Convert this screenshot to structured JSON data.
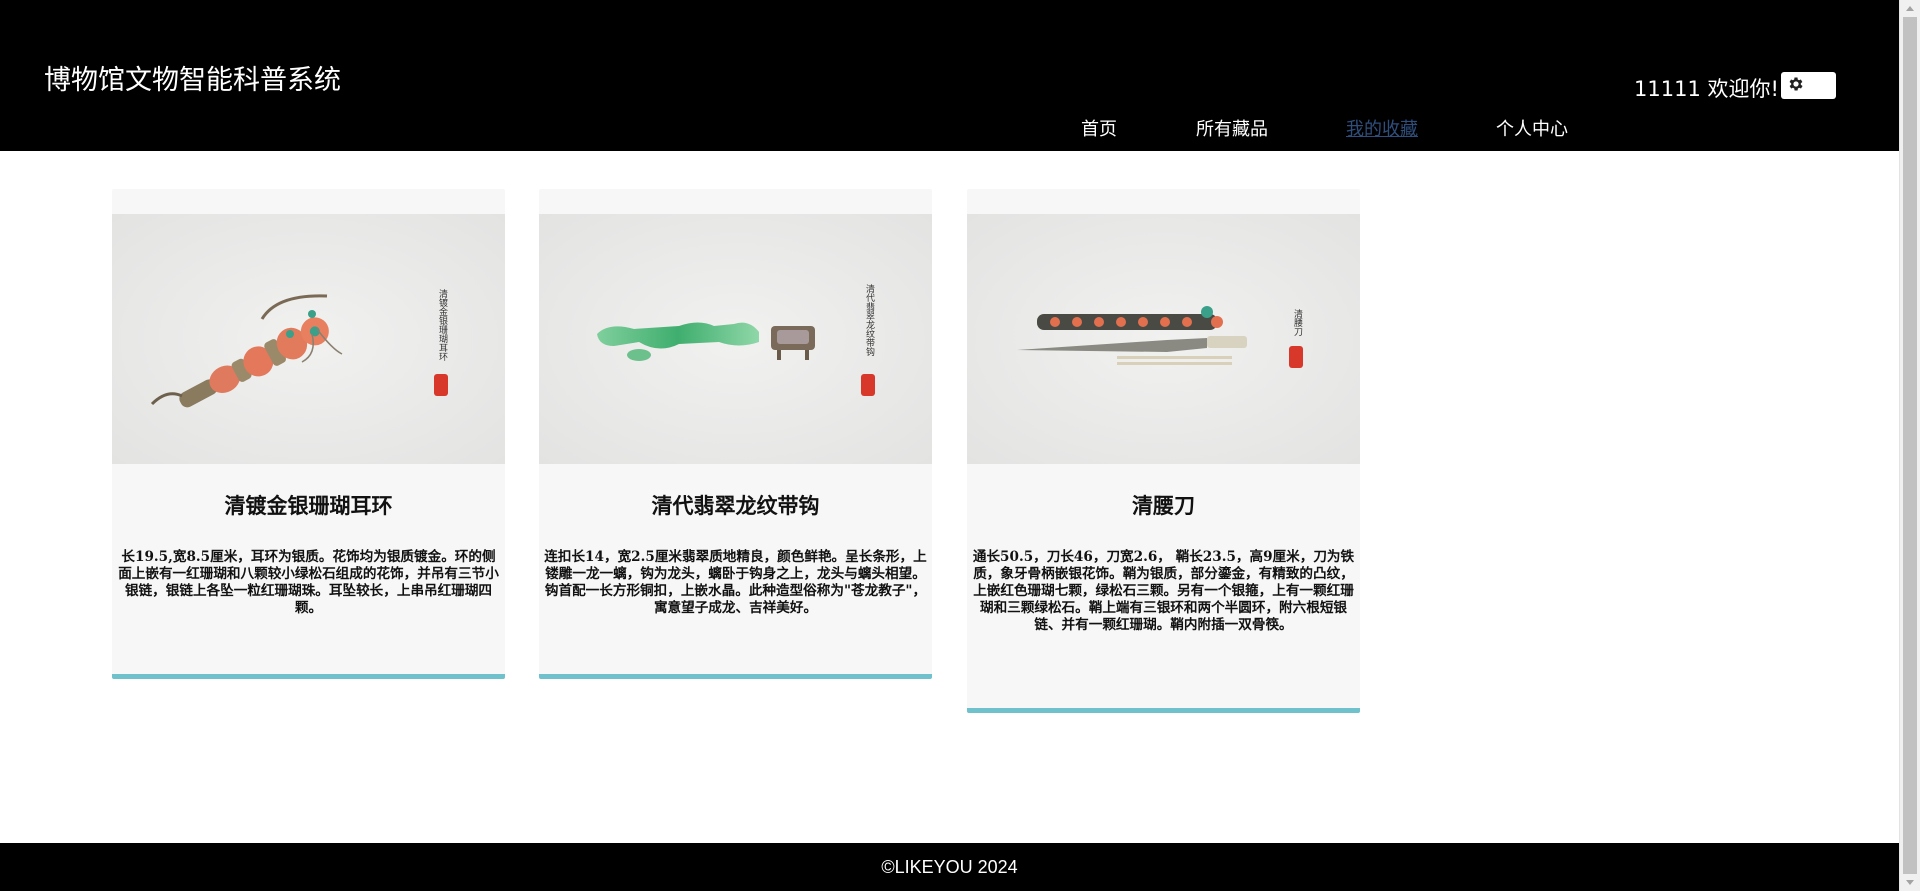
{
  "header": {
    "site_title": "博物馆文物智能科普系统",
    "welcome": "11111 欢迎你!",
    "settings_icon": "gear-icon"
  },
  "nav": {
    "items": [
      {
        "label": "首页",
        "active": false
      },
      {
        "label": "所有藏品",
        "active": false
      },
      {
        "label": "我的收藏",
        "active": true
      },
      {
        "label": "个人中心",
        "active": false
      }
    ]
  },
  "collections": [
    {
      "title": "清镀金银珊瑚耳环",
      "description": "长19.5,宽8.5厘米，耳环为银质。花饰均为银质镀金。环的侧面上嵌有一红珊瑚和八颗较小绿松石组成的花饰，并吊有三节小银链，银链上各坠一粒红珊瑚珠。耳坠较长，上串吊红珊瑚四颗。",
      "image_caption": "清镀金银珊瑚耳环"
    },
    {
      "title": "清代翡翠龙纹带钩",
      "description": "连扣长14，宽2.5厘米翡翠质地精良，颜色鲜艳。呈长条形，上镂雕一龙一螭，钩为龙头，螭卧于钩身之上，龙头与螭头相望。钩首配一长方形铜扣，上嵌水晶。此种造型俗称为\"苍龙教子\"，寓意望子成龙、吉祥美好。",
      "image_caption": "清代翡翠龙纹带钩"
    },
    {
      "title": "清腰刀",
      "description": "通长50.5，刀长46，刀宽2.6， 鞘长23.5，高9厘米，刀为铁质，象牙骨柄嵌银花饰。鞘为银质，部分鎏金，有精致的凸纹，上嵌红色珊瑚七颗，绿松石三颗。另有一个银箍，上有一颗红珊瑚和三颗绿松石。鞘上端有三银环和两个半圆环，附六根短银链、并有一颗红珊瑚。鞘内附插一双骨筷。",
      "image_caption": "清腰刀"
    }
  ],
  "footer": {
    "copyright": "©LIKEYOU 2024"
  },
  "colors": {
    "header_bg": "#000000",
    "card_accent": "#6fc1cc",
    "active_nav": "#2f4e7c"
  }
}
